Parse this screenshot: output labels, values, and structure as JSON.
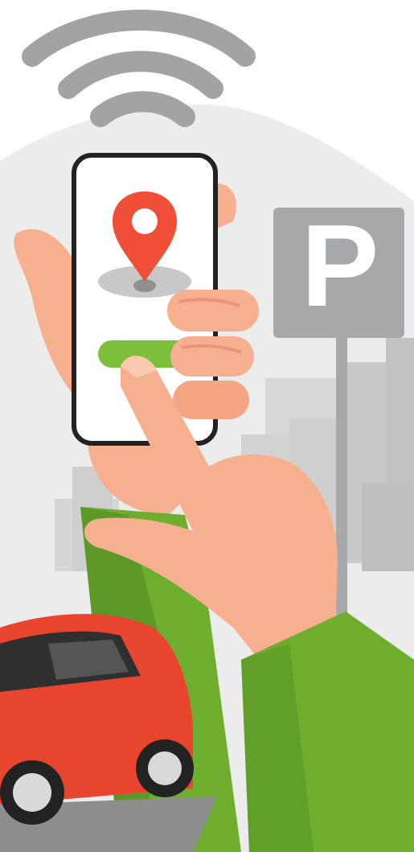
{
  "illustration": {
    "parking_sign": {
      "letter": "P"
    },
    "colors": {
      "background_blob": "#ececec",
      "buildings_light": "#dcdcdc",
      "buildings_dark": "#c4c4c4",
      "sign_gray": "#a7a8aa",
      "wifi_gray": "#a3a3a3",
      "skin": "#f7b08f",
      "skin_shadow": "#e8957a",
      "sleeve_green": "#6fad2e",
      "sleeve_dark": "#4e8a1f",
      "phone_outline": "#222222",
      "pin_red": "#f04e37",
      "pin_ground": "#c8c8c8",
      "progress_green": "#7cbf3a",
      "car_red": "#e8452f",
      "car_dark": "#2f2f2f",
      "road_gray": "#8d8d8d"
    },
    "icons": [
      "wifi-signal-icon",
      "location-pin-icon",
      "parking-sign-icon",
      "car-icon"
    ]
  }
}
